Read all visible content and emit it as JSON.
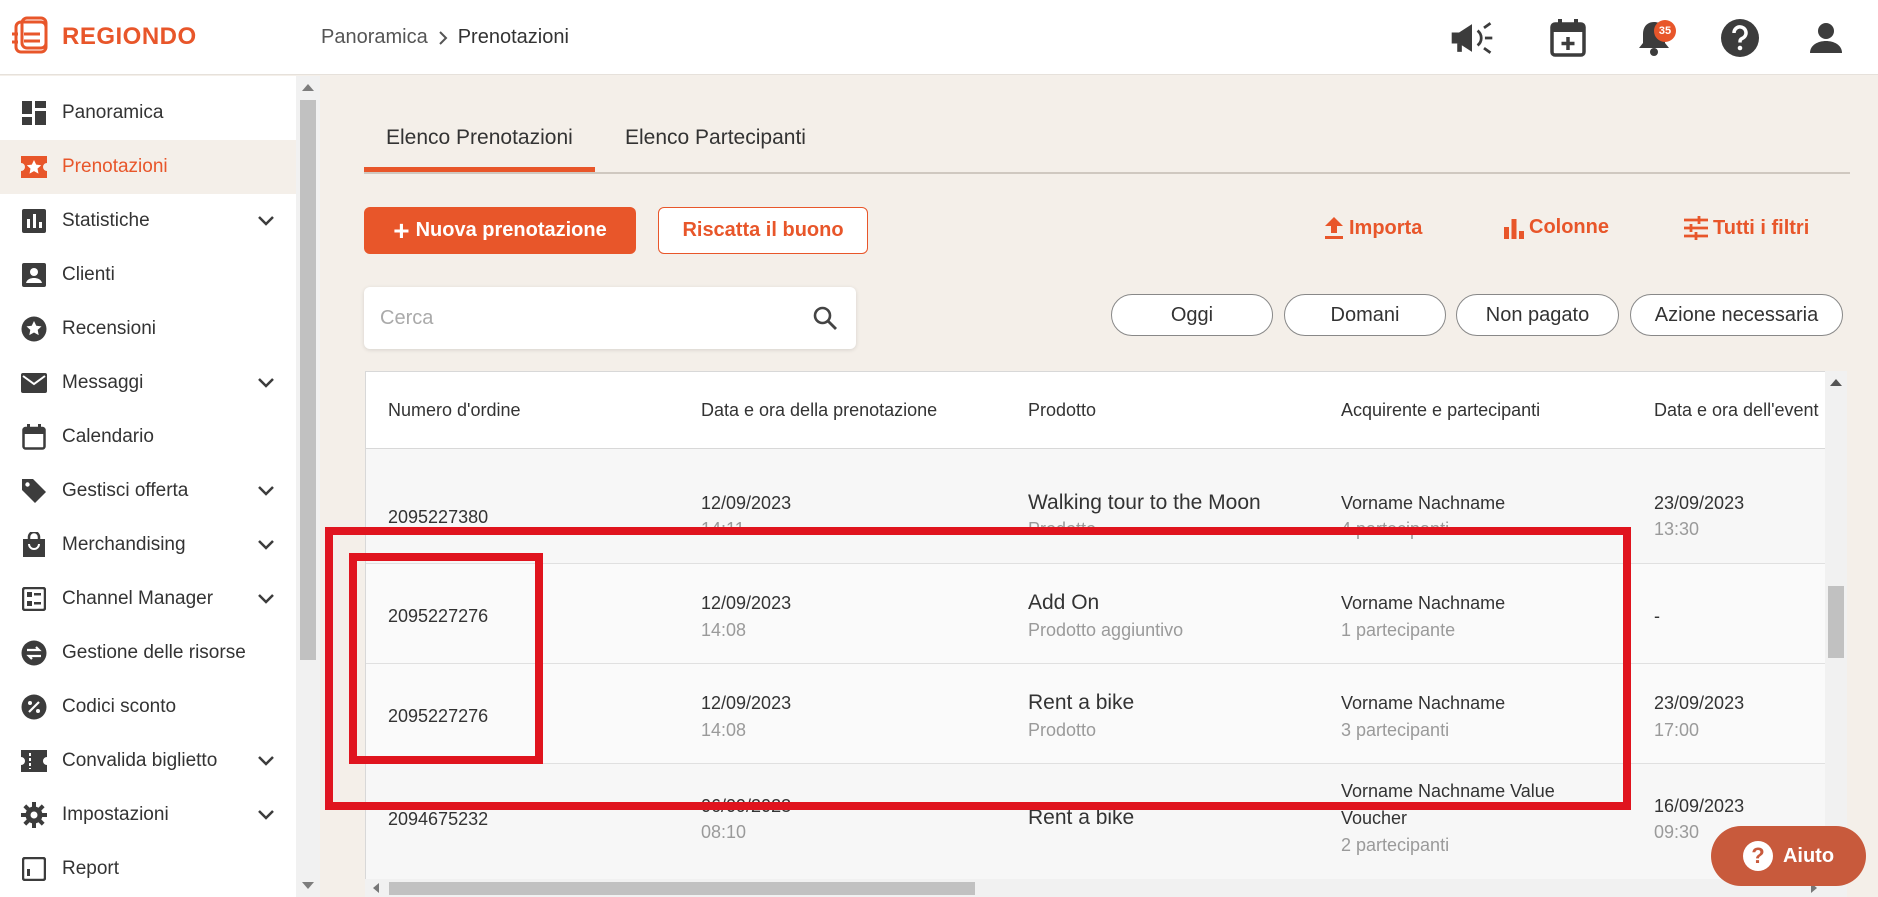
{
  "brand": {
    "name": "REGIONDO",
    "accent": "#e8562a"
  },
  "breadcrumb": {
    "parent": "Panoramica",
    "current": "Prenotazioni"
  },
  "header": {
    "icons": [
      "megaphone-icon",
      "calendar-add-icon",
      "bell-icon",
      "help-icon",
      "user-icon"
    ],
    "notification_count": "35"
  },
  "sidebar": {
    "items": [
      {
        "label": "Panoramica",
        "icon": "dashboard-icon",
        "expandable": false
      },
      {
        "label": "Prenotazioni",
        "icon": "star-ticket-icon",
        "expandable": false,
        "active": true
      },
      {
        "label": "Statistiche",
        "icon": "bar-chart-icon",
        "expandable": true
      },
      {
        "label": "Clienti",
        "icon": "person-card-icon",
        "expandable": false
      },
      {
        "label": "Recensioni",
        "icon": "star-circle-icon",
        "expandable": false
      },
      {
        "label": "Messaggi",
        "icon": "mail-icon",
        "expandable": true
      },
      {
        "label": "Calendario",
        "icon": "calendar-icon",
        "expandable": false
      },
      {
        "label": "Gestisci offerta",
        "icon": "tag-icon",
        "expandable": true
      },
      {
        "label": "Merchandising",
        "icon": "shopping-bag-icon",
        "expandable": true
      },
      {
        "label": "Channel Manager",
        "icon": "list-icon",
        "expandable": true
      },
      {
        "label": "Gestione delle risorse",
        "icon": "swap-icon",
        "expandable": false
      },
      {
        "label": "Codici sconto",
        "icon": "percent-icon",
        "expandable": false
      },
      {
        "label": "Convalida biglietto",
        "icon": "ticket-icon",
        "expandable": true
      },
      {
        "label": "Impostazioni",
        "icon": "gear-icon",
        "expandable": true
      },
      {
        "label": "Report",
        "icon": "report-icon",
        "expandable": false
      }
    ]
  },
  "tabs": [
    {
      "label": "Elenco Prenotazioni",
      "active": true
    },
    {
      "label": "Elenco Partecipanti",
      "active": false
    }
  ],
  "toolbar": {
    "new_booking": "Nuova prenotazione",
    "redeem_voucher": "Riscatta il buono",
    "import": "Importa",
    "columns": "Colonne",
    "all_filters": "Tutti i filtri"
  },
  "search": {
    "placeholder": "Cerca",
    "value": ""
  },
  "quick_filters": [
    "Oggi",
    "Domani",
    "Non pagato",
    "Azione necessaria"
  ],
  "table": {
    "columns": [
      "Numero d'ordine",
      "Data e ora della prenotazione",
      "Prodotto",
      "Acquirente e partecipanti",
      "Data e ora dell'event"
    ],
    "rows": [
      {
        "order": "2095227380",
        "booking_date": "12/09/2023",
        "booking_time": "14:11",
        "product": "Walking tour to the Moon",
        "product_type": "Prodotto",
        "buyer": "Vorname Nachname",
        "participants": "4 partecipanti",
        "event_date": "23/09/2023",
        "event_time": "13:30"
      },
      {
        "order": "2095227276",
        "booking_date": "12/09/2023",
        "booking_time": "14:08",
        "product": "Add On",
        "product_type": "Prodotto aggiuntivo",
        "buyer": "Vorname Nachname",
        "participants": "1 partecipante",
        "event_date": "-",
        "event_time": ""
      },
      {
        "order": "2095227276",
        "booking_date": "12/09/2023",
        "booking_time": "14:08",
        "product": "Rent a bike",
        "product_type": "Prodotto",
        "buyer": "Vorname Nachname",
        "participants": "3 partecipanti",
        "event_date": "23/09/2023",
        "event_time": "17:00"
      },
      {
        "order": "2094675232",
        "booking_date": "06/09/2023",
        "booking_time": "08:10",
        "product": "Rent a bike",
        "product_type": "",
        "buyer": "Vorname Nachname Value",
        "buyer_line2": "Voucher",
        "participants": "2 partecipanti",
        "event_date": "16/09/2023",
        "event_time": "09:30"
      }
    ]
  },
  "help_button": {
    "label": "Aiuto"
  },
  "highlight_color": "#e0141e"
}
